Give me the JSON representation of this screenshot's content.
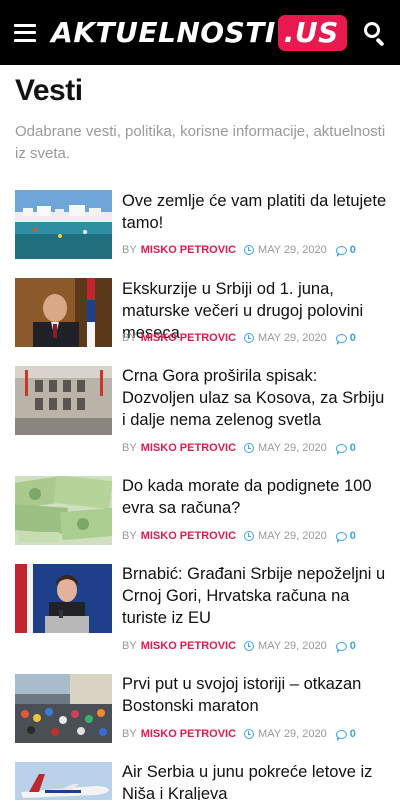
{
  "header": {
    "logo_main": "AKTUELNOSTI",
    "logo_accent": ".US"
  },
  "page": {
    "title": "Vesti",
    "description": "Odabrane vesti, politika, korisne informacije, aktuelnosti iz sveta."
  },
  "meta_labels": {
    "by": "BY"
  },
  "articles": [
    {
      "title": "Ove zemlje će vam platiti da letujete tamo!",
      "author": "MISKO PETROVIC",
      "date": "MAY 29, 2020",
      "comments": "0"
    },
    {
      "title": "Ekskurzije u Srbiji od 1. juna, maturske večeri u drugoj polovini meseca",
      "author": "MISKO PETROVIC",
      "date": "MAY 29, 2020",
      "comments": "0"
    },
    {
      "title": "Crna Gora proširila spisak: Dozvoljen ulaz sa Kosova, za Srbiju i dalje nema zelenog svetla",
      "author": "MISKO PETROVIC",
      "date": "MAY 29, 2020",
      "comments": "0"
    },
    {
      "title": "Do kada morate da podignete 100 evra sa računa?",
      "author": "MISKO PETROVIC",
      "date": "MAY 29, 2020",
      "comments": "0"
    },
    {
      "title": "Brnabić: Građani Srbije nepoželjni u Crnoj Gori, Hrvatska računa na turiste iz EU",
      "author": "MISKO PETROVIC",
      "date": "MAY 29, 2020",
      "comments": "0"
    },
    {
      "title": "Prvi put u svojoj istoriji – otkazan Bostonski maraton",
      "author": "MISKO PETROVIC",
      "date": "MAY 29, 2020",
      "comments": "0"
    },
    {
      "title": "Air Serbia u junu pokreće letove iz Niša i Kraljeva",
      "author": "",
      "date": "",
      "comments": ""
    }
  ]
}
